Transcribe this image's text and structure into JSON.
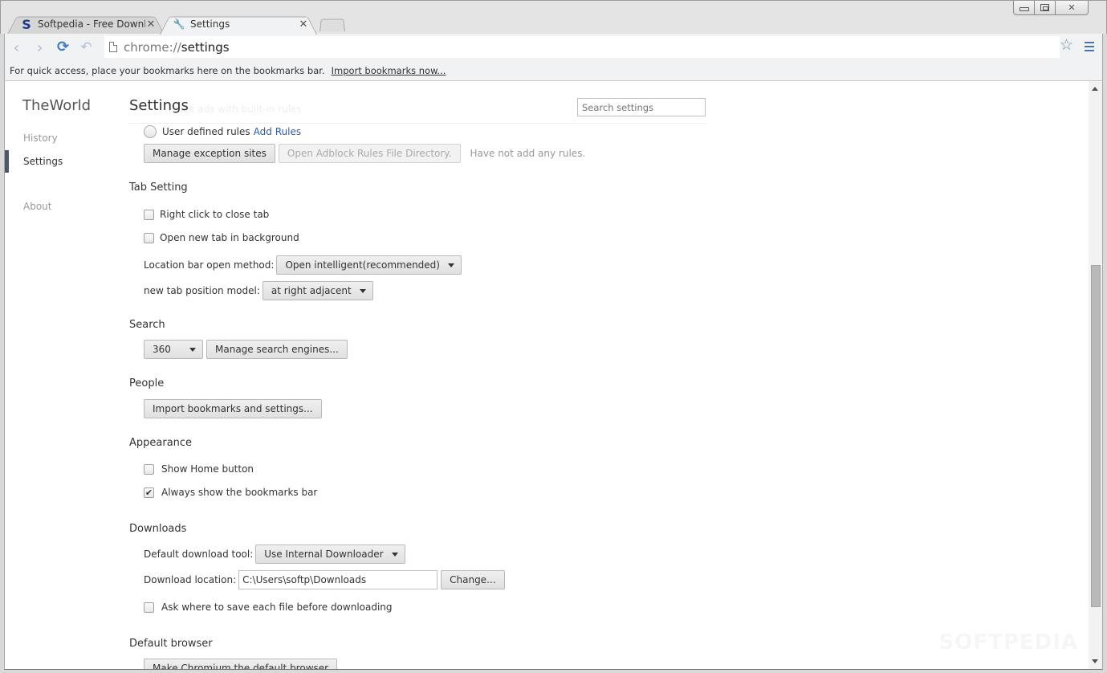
{
  "window": {
    "controls": {
      "minimize": "minimize",
      "maximize": "maximize",
      "close": "✕"
    }
  },
  "tabs": [
    {
      "title": "Softpedia - Free Download",
      "favicon": "S",
      "close": "✕",
      "active": false
    },
    {
      "title": "Settings",
      "favicon": "🔧",
      "close": "✕",
      "active": true
    }
  ],
  "toolbar": {
    "back_icon": "‹",
    "forward_icon": "›",
    "reload_icon": "⟳",
    "undo_icon": "↶",
    "url_scheme": "chrome://",
    "url_path": "settings",
    "star_icon": "☆"
  },
  "bookmarks_bar": {
    "message": "For quick access, place your bookmarks here on the bookmarks bar.",
    "link": "Import bookmarks now..."
  },
  "sidebar": {
    "brand": "TheWorld",
    "items": [
      {
        "label": "History",
        "active": false
      },
      {
        "label": "Settings",
        "active": true
      },
      {
        "label": "About",
        "active": false
      }
    ]
  },
  "header": {
    "title": "Settings",
    "ghost_text": "Block ads with built-in rules",
    "search_placeholder": "Search settings"
  },
  "adblock": {
    "user_rules_label": "User defined rules",
    "add_rules_link": "Add Rules",
    "manage_exceptions": "Manage exception sites",
    "open_rules_dir": "Open Adblock Rules File Directory.",
    "status": "Have not add any rules."
  },
  "tab_setting": {
    "title": "Tab Setting",
    "right_click_close": {
      "label": "Right click to close tab",
      "checked": false
    },
    "open_in_background": {
      "label": "Open new tab in background",
      "checked": false
    },
    "location_bar_label": "Location bar open method:",
    "location_bar_value": "Open intelligent(recommended)",
    "new_tab_position_label": "new tab position model:",
    "new_tab_position_value": "at right adjacent"
  },
  "search": {
    "title": "Search",
    "engine_value": "360",
    "manage_button": "Manage search engines..."
  },
  "people": {
    "title": "People",
    "import_button": "Import bookmarks and settings..."
  },
  "appearance": {
    "title": "Appearance",
    "show_home": {
      "label": "Show Home button",
      "checked": false
    },
    "show_bookmarks_bar": {
      "label": "Always show the bookmarks bar",
      "checked": true,
      "mark": "✔"
    }
  },
  "downloads": {
    "title": "Downloads",
    "tool_label": "Default download tool:",
    "tool_value": "Use Internal Downloader",
    "location_label": "Download location:",
    "location_value": "C:\\Users\\softp\\Downloads",
    "change_button": "Change...",
    "ask_where": {
      "label": "Ask where to save each file before downloading",
      "checked": false
    }
  },
  "default_browser": {
    "title": "Default browser",
    "make_default_button": "Make Chromium the default browser"
  },
  "watermark": "SOFTPEDIA"
}
